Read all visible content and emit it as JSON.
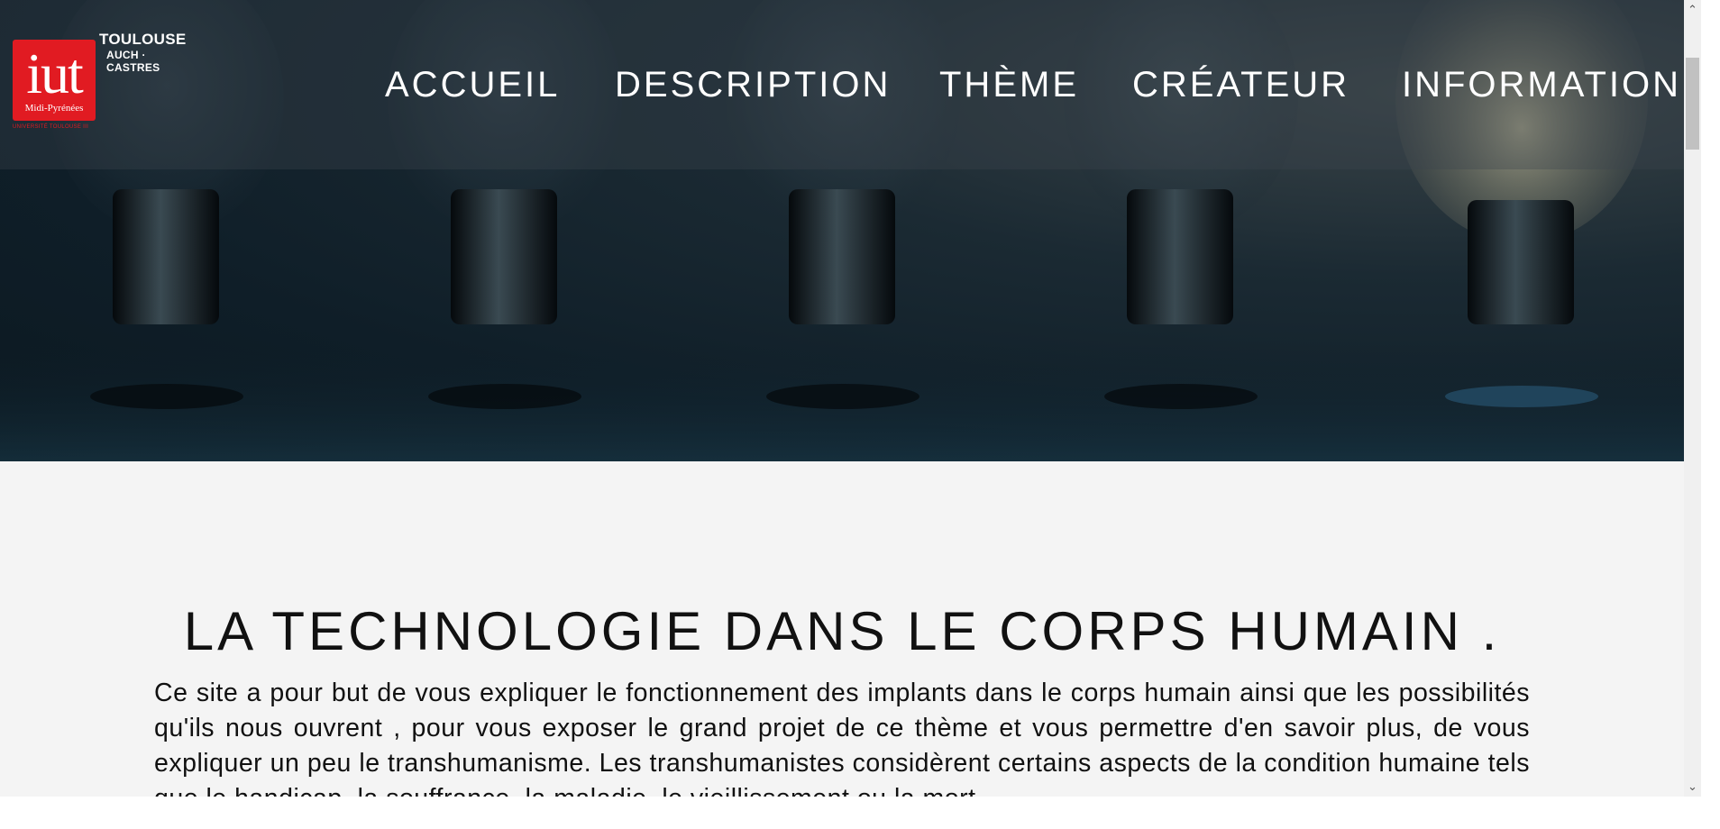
{
  "logo": {
    "mark": "iut",
    "region": "Midi-Pyrénées",
    "city": "TOULOUSE",
    "sites": "AUCH · CASTRES",
    "university": "UNIVERSITÉ TOULOUSE III",
    "brand_color": "#e11b22"
  },
  "nav": {
    "items": [
      {
        "label": "ACCUEIL"
      },
      {
        "label": "DESCRIPTION"
      },
      {
        "label": "THÈME"
      },
      {
        "label": "CRÉATEUR"
      },
      {
        "label": "INFORMATION"
      }
    ]
  },
  "main": {
    "title": "LA TECHNOLOGIE DANS LE CORPS HUMAIN .",
    "intro": "Ce site a pour but de vous expliquer le fonctionnement des implants dans le corps humain ainsi que les possibilités qu'ils nous ouvrent , pour vous exposer le grand projet de ce thème et vous permettre d'en savoir plus, de vous expliquer un peu le transhumanisme. Les transhumanistes considèrent certains aspects de la condition humaine tels que le handicap, la souffrance, la maladie, le vieillissement ou la mort"
  },
  "scrollbar": {
    "up_icon": "chevron-up-icon",
    "down_icon": "chevron-down-icon"
  }
}
